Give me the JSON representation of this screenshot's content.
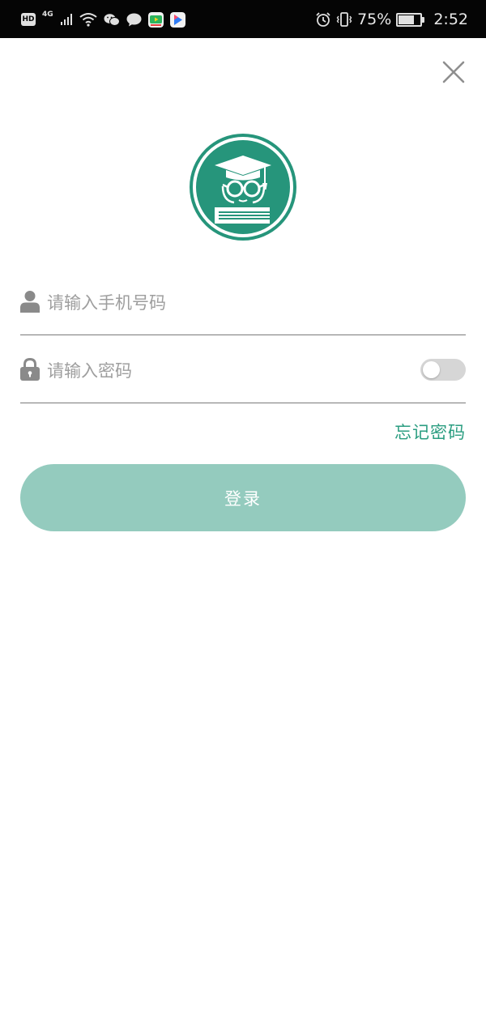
{
  "status_bar": {
    "hd": "HD",
    "network": "4G",
    "battery_percent": "75%",
    "battery_level": 0.75,
    "time": "2:52",
    "icons": [
      "signal-icon",
      "wifi-icon",
      "wechat-icon",
      "message-icon",
      "app-icon-video",
      "app-icon-player",
      "alarm-icon",
      "vibrate-icon",
      "battery-icon"
    ]
  },
  "header": {
    "close_icon": "close-icon"
  },
  "logo": {
    "icon": "graduate-logo-icon",
    "color": "#26957b"
  },
  "form": {
    "phone": {
      "placeholder": "请输入手机号码",
      "value": "",
      "icon": "user-icon"
    },
    "password": {
      "placeholder": "请输入密码",
      "value": "",
      "icon": "lock-icon",
      "show_password_toggle": false
    },
    "forgot_password": "忘记密码",
    "login_button": "登录"
  },
  "colors": {
    "accent": "#2a9d80",
    "button_bg": "#94cbbe",
    "status_bar_bg": "#050505"
  }
}
